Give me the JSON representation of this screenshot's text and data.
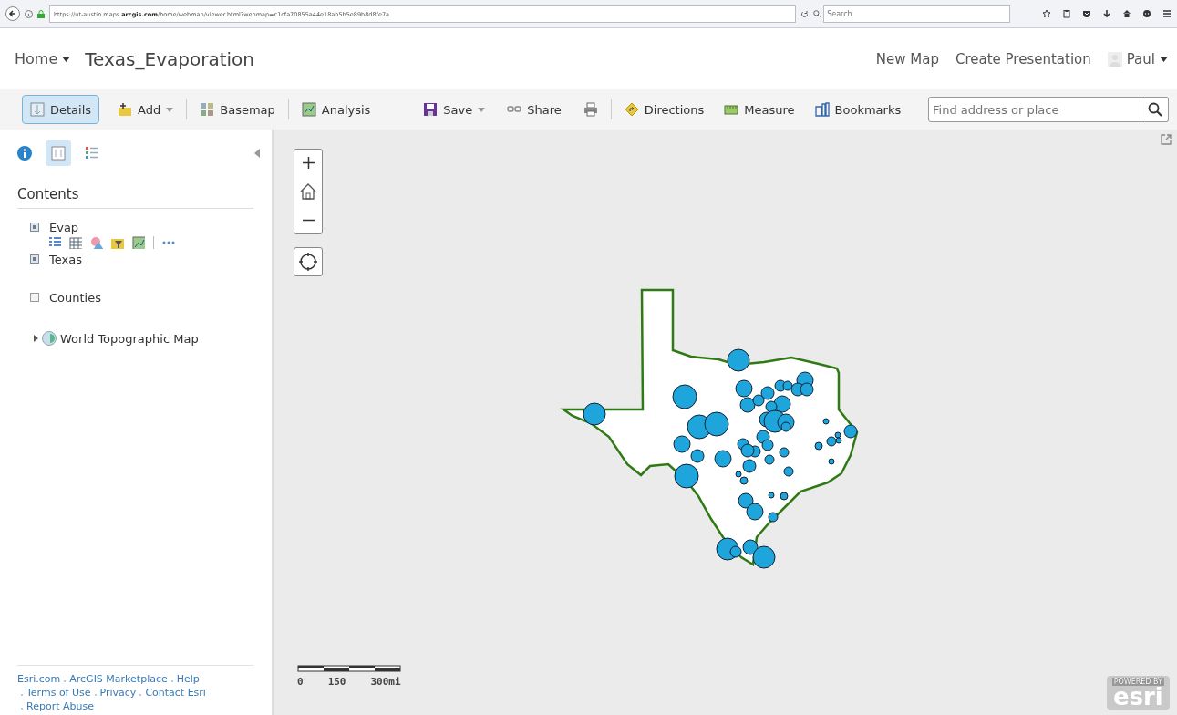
{
  "browser": {
    "url": "https://ut-austin.maps.**arcgis.com**/home/webmap/viewer.html?webmap=c1cfa70855a44e18ab5b5e89b8d8fe7a",
    "search": {
      "placeholder": "Search"
    }
  },
  "header": {
    "home": "Home",
    "title": "Texas_Evaporation",
    "links": [
      "New Map",
      "Create Presentation"
    ],
    "user": "Paul"
  },
  "toolbar": {
    "groups": [
      [
        {
          "label": "Details",
          "kind": "button",
          "selected": true
        },
        {
          "label": "Add",
          "kind": "dropdown",
          "selected": false
        }
      ],
      [
        {
          "label": "Basemap",
          "kind": "button",
          "selected": false
        }
      ],
      [
        {
          "label": "Analysis",
          "kind": "button",
          "selected": false
        },
        {
          "label": "Save",
          "kind": "dropdown",
          "selected": false
        },
        {
          "label": "Share",
          "kind": "button",
          "selected": false
        },
        {
          "kind": "icon",
          "selected": false
        }
      ],
      [
        {
          "label": "Directions",
          "kind": "button",
          "selected": false
        },
        {
          "label": "Measure",
          "kind": "button",
          "selected": false
        },
        {
          "label": "Bookmarks",
          "kind": "button",
          "selected": false
        }
      ]
    ],
    "search": {
      "placeholder": "Find address or place"
    }
  },
  "sidebar": {
    "tabs": [
      {
        "selected": false
      },
      {
        "selected": true
      },
      {
        "selected": false
      }
    ],
    "title": "Contents",
    "layers": [
      {
        "name": "Evap",
        "kind": "layer",
        "checked": true,
        "tools": true
      },
      {
        "name": "Texas",
        "kind": "layer",
        "checked": true,
        "tools": false
      },
      {
        "name": "Counties",
        "kind": "layer",
        "checked": false,
        "tools": false
      },
      {
        "name": "World Topographic Map",
        "kind": "basemap",
        "expanded": false
      }
    ],
    "footer_links": [
      "Esri.com",
      "ArcGIS Marketplace",
      "Help",
      "Terms of Use",
      "Privacy",
      "Contact Esri",
      "Report Abuse"
    ]
  },
  "map": {
    "scale_labels": [
      "0",
      "150",
      "300mi"
    ],
    "logo": {
      "tagline": "POWERED BY",
      "name": "esri"
    }
  }
}
